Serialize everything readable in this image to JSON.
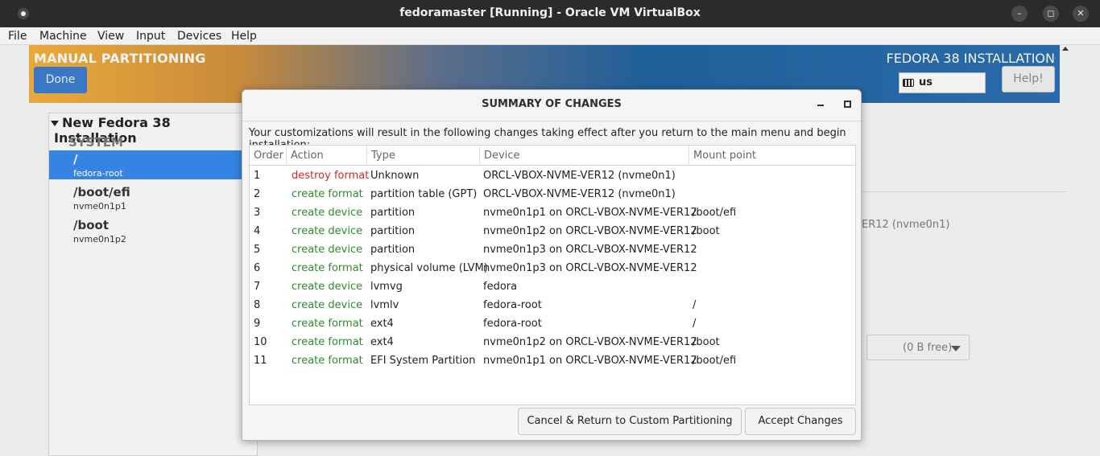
{
  "window": {
    "title": "fedoramaster [Running] - Oracle VM VirtualBox",
    "controls": {
      "minimize": "–",
      "restore": "◻",
      "close": "✕"
    }
  },
  "menubar": {
    "items": [
      "File",
      "Machine",
      "View",
      "Input",
      "Devices",
      "Help"
    ]
  },
  "installer": {
    "section_title": "MANUAL PARTITIONING",
    "product_title": "FEDORA 38 INSTALLATION",
    "done_label": "Done",
    "keyboard_layout": "us",
    "help_label": "Help!"
  },
  "tree": {
    "header": "New Fedora 38 Installation",
    "group": "SYSTEM",
    "items": [
      {
        "mount": "/",
        "device": "fedora-root",
        "selected": true
      },
      {
        "mount": "/boot/efi",
        "device": "nvme0n1p1",
        "selected": false
      },
      {
        "mount": "/boot",
        "device": "nvme0n1p2",
        "selected": false
      }
    ]
  },
  "right_panel": {
    "device_hint": "ER12 (nvme0n1)",
    "free_space": "(0 B free)"
  },
  "dialog": {
    "title": "SUMMARY OF CHANGES",
    "message": "Your customizations will result in the following changes taking effect after you return to the main menu and begin installation:",
    "columns": [
      "Order",
      "Action",
      "Type",
      "Device",
      "Mount point"
    ],
    "rows": [
      {
        "order": "1",
        "action": "destroy format",
        "type": "Unknown",
        "device": "ORCL-VBOX-NVME-VER12 (nvme0n1)",
        "mount": ""
      },
      {
        "order": "2",
        "action": "create format",
        "type": "partition table (GPT)",
        "device": "ORCL-VBOX-NVME-VER12 (nvme0n1)",
        "mount": ""
      },
      {
        "order": "3",
        "action": "create device",
        "type": "partition",
        "device": "nvme0n1p1 on ORCL-VBOX-NVME-VER12",
        "mount": "/boot/efi"
      },
      {
        "order": "4",
        "action": "create device",
        "type": "partition",
        "device": "nvme0n1p2 on ORCL-VBOX-NVME-VER12",
        "mount": "/boot"
      },
      {
        "order": "5",
        "action": "create device",
        "type": "partition",
        "device": "nvme0n1p3 on ORCL-VBOX-NVME-VER12",
        "mount": ""
      },
      {
        "order": "6",
        "action": "create format",
        "type": "physical volume (LVM)",
        "device": "nvme0n1p3 on ORCL-VBOX-NVME-VER12",
        "mount": ""
      },
      {
        "order": "7",
        "action": "create device",
        "type": "lvmvg",
        "device": "fedora",
        "mount": ""
      },
      {
        "order": "8",
        "action": "create device",
        "type": "lvmlv",
        "device": "fedora-root",
        "mount": "/"
      },
      {
        "order": "9",
        "action": "create format",
        "type": "ext4",
        "device": "fedora-root",
        "mount": "/"
      },
      {
        "order": "10",
        "action": "create format",
        "type": "ext4",
        "device": "nvme0n1p2 on ORCL-VBOX-NVME-VER12",
        "mount": "/boot"
      },
      {
        "order": "11",
        "action": "create format",
        "type": "EFI System Partition",
        "device": "nvme0n1p1 on ORCL-VBOX-NVME-VER12",
        "mount": "/boot/efi"
      }
    ],
    "cancel_label": "Cancel & Return to Custom Partitioning",
    "accept_label": "Accept Changes"
  },
  "colors": {
    "create_action": "#2e8b2e",
    "destroy_action": "#d62828",
    "selection": "#3584e4"
  }
}
